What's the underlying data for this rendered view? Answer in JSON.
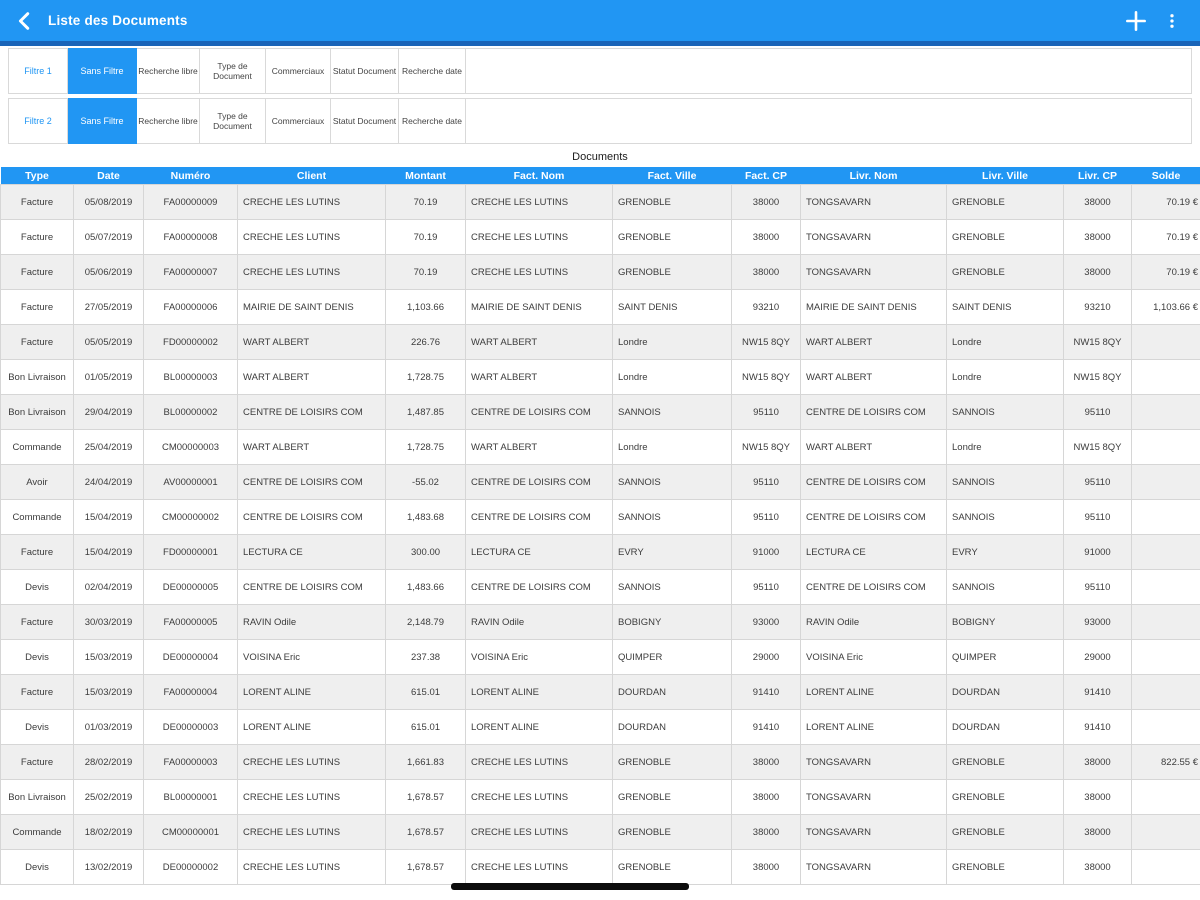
{
  "appbar": {
    "title": "Liste des Documents",
    "accent_color": "#2196f3",
    "accent_dark_color": "#1a64b8"
  },
  "filters": {
    "rows": [
      {
        "label": "Filtre 1",
        "active": "Sans Filtre",
        "buttons": [
          "Recherche libre",
          "Type de Document",
          "Commerciaux",
          "Statut Document",
          "Recherche date"
        ]
      },
      {
        "label": "Filtre 2",
        "active": "Sans Filtre",
        "buttons": [
          "Recherche libre",
          "Type de Document",
          "Commerciaux",
          "Statut Document",
          "Recherche date"
        ]
      }
    ]
  },
  "table": {
    "title": "Documents",
    "columns": [
      "Type",
      "Date",
      "Numéro",
      "Client",
      "Montant",
      "Fact. Nom",
      "Fact. Ville",
      "Fact. CP",
      "Livr. Nom",
      "Livr. Ville",
      "Livr. CP",
      "Solde"
    ],
    "rows": [
      [
        "Facture",
        "05/08/2019",
        "FA00000009",
        "CRECHE LES LUTINS",
        "70.19",
        "CRECHE LES LUTINS",
        "GRENOBLE",
        "38000",
        "TONGSAVARN",
        "GRENOBLE",
        "38000",
        "70.19 €"
      ],
      [
        "Facture",
        "05/07/2019",
        "FA00000008",
        "CRECHE LES LUTINS",
        "70.19",
        "CRECHE LES LUTINS",
        "GRENOBLE",
        "38000",
        "TONGSAVARN",
        "GRENOBLE",
        "38000",
        "70.19 €"
      ],
      [
        "Facture",
        "05/06/2019",
        "FA00000007",
        "CRECHE LES LUTINS",
        "70.19",
        "CRECHE LES LUTINS",
        "GRENOBLE",
        "38000",
        "TONGSAVARN",
        "GRENOBLE",
        "38000",
        "70.19 €"
      ],
      [
        "Facture",
        "27/05/2019",
        "FA00000006",
        "MAIRIE DE SAINT DENIS",
        "1,103.66",
        "MAIRIE DE SAINT DENIS",
        "SAINT DENIS",
        "93210",
        "MAIRIE DE SAINT DENIS",
        "SAINT DENIS",
        "93210",
        "1,103.66 €"
      ],
      [
        "Facture",
        "05/05/2019",
        "FD00000002",
        "WART ALBERT",
        "226.76",
        "WART ALBERT",
        "Londre",
        "NW15 8QY",
        "WART ALBERT",
        "Londre",
        "NW15 8QY",
        ""
      ],
      [
        "Bon Livraison",
        "01/05/2019",
        "BL00000003",
        "WART ALBERT",
        "1,728.75",
        "WART ALBERT",
        "Londre",
        "NW15 8QY",
        "WART ALBERT",
        "Londre",
        "NW15 8QY",
        ""
      ],
      [
        "Bon Livraison",
        "29/04/2019",
        "BL00000002",
        "CENTRE DE LOISIRS COM",
        "1,487.85",
        "CENTRE DE LOISIRS COM",
        "SANNOIS",
        "95110",
        "CENTRE DE LOISIRS COM",
        "SANNOIS",
        "95110",
        ""
      ],
      [
        "Commande",
        "25/04/2019",
        "CM00000003",
        "WART ALBERT",
        "1,728.75",
        "WART ALBERT",
        "Londre",
        "NW15 8QY",
        "WART ALBERT",
        "Londre",
        "NW15 8QY",
        ""
      ],
      [
        "Avoir",
        "24/04/2019",
        "AV00000001",
        "CENTRE DE LOISIRS COM",
        "-55.02",
        "CENTRE DE LOISIRS COM",
        "SANNOIS",
        "95110",
        "CENTRE DE LOISIRS COM",
        "SANNOIS",
        "95110",
        ""
      ],
      [
        "Commande",
        "15/04/2019",
        "CM00000002",
        "CENTRE DE LOISIRS COM",
        "1,483.68",
        "CENTRE DE LOISIRS COM",
        "SANNOIS",
        "95110",
        "CENTRE DE LOISIRS COM",
        "SANNOIS",
        "95110",
        ""
      ],
      [
        "Facture",
        "15/04/2019",
        "FD00000001",
        "LECTURA CE",
        "300.00",
        "LECTURA CE",
        "EVRY",
        "91000",
        "LECTURA CE",
        "EVRY",
        "91000",
        ""
      ],
      [
        "Devis",
        "02/04/2019",
        "DE00000005",
        "CENTRE DE LOISIRS COM",
        "1,483.66",
        "CENTRE DE LOISIRS COM",
        "SANNOIS",
        "95110",
        "CENTRE DE LOISIRS COM",
        "SANNOIS",
        "95110",
        ""
      ],
      [
        "Facture",
        "30/03/2019",
        "FA00000005",
        "RAVIN Odile",
        "2,148.79",
        "RAVIN Odile",
        "BOBIGNY",
        "93000",
        "RAVIN Odile",
        "BOBIGNY",
        "93000",
        ""
      ],
      [
        "Devis",
        "15/03/2019",
        "DE00000004",
        "VOISINA Eric",
        "237.38",
        "VOISINA Eric",
        "QUIMPER",
        "29000",
        "VOISINA Eric",
        "QUIMPER",
        "29000",
        ""
      ],
      [
        "Facture",
        "15/03/2019",
        "FA00000004",
        "LORENT ALINE",
        "615.01",
        "LORENT ALINE",
        "DOURDAN",
        "91410",
        "LORENT ALINE",
        "DOURDAN",
        "91410",
        ""
      ],
      [
        "Devis",
        "01/03/2019",
        "DE00000003",
        "LORENT ALINE",
        "615.01",
        "LORENT ALINE",
        "DOURDAN",
        "91410",
        "LORENT ALINE",
        "DOURDAN",
        "91410",
        ""
      ],
      [
        "Facture",
        "28/02/2019",
        "FA00000003",
        "CRECHE LES LUTINS",
        "1,661.83",
        "CRECHE LES LUTINS",
        "GRENOBLE",
        "38000",
        "TONGSAVARN",
        "GRENOBLE",
        "38000",
        "822.55 €"
      ],
      [
        "Bon Livraison",
        "25/02/2019",
        "BL00000001",
        "CRECHE LES LUTINS",
        "1,678.57",
        "CRECHE LES LUTINS",
        "GRENOBLE",
        "38000",
        "TONGSAVARN",
        "GRENOBLE",
        "38000",
        ""
      ],
      [
        "Commande",
        "18/02/2019",
        "CM00000001",
        "CRECHE LES LUTINS",
        "1,678.57",
        "CRECHE LES LUTINS",
        "GRENOBLE",
        "38000",
        "TONGSAVARN",
        "GRENOBLE",
        "38000",
        ""
      ],
      [
        "Devis",
        "13/02/2019",
        "DE00000002",
        "CRECHE LES LUTINS",
        "1,678.57",
        "CRECHE LES LUTINS",
        "GRENOBLE",
        "38000",
        "TONGSAVARN",
        "GRENOBLE",
        "38000",
        ""
      ]
    ]
  }
}
